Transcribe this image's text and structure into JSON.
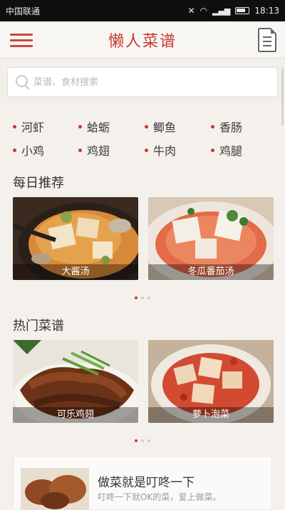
{
  "status_bar": {
    "carrier": "中国联通",
    "time": "18:13"
  },
  "app": {
    "title": "懒人菜谱"
  },
  "search": {
    "placeholder": "菜谱、食材搜索"
  },
  "tags": [
    "河虾",
    "蛤蛎",
    "鲫鱼",
    "香肠",
    "小鸡",
    "鸡翅",
    "牛肉",
    "鸡腿"
  ],
  "daily": {
    "title": "每日推荐",
    "cards": [
      {
        "label": "大酱汤"
      },
      {
        "label": "冬瓜番茄汤"
      }
    ]
  },
  "hot": {
    "title": "热门菜谱",
    "cards": [
      {
        "label": "可乐鸡翅"
      },
      {
        "label": "萝卜泡菜"
      }
    ]
  },
  "banner": {
    "title": "做菜就是叮咚一下",
    "subtitle": "叮咚一下就OK的菜，爱上做菜。"
  },
  "colors": {
    "accent": "#c63a2f",
    "background": "#f4f1ec"
  },
  "icons": [
    "menu-icon",
    "document-icon",
    "search-icon"
  ]
}
